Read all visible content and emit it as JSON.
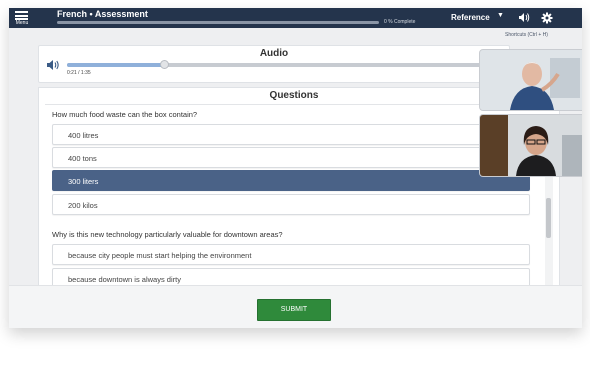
{
  "topbar": {
    "menu_label": "Menu",
    "title": "French • Assessment",
    "progress_text": "0 % Complete",
    "progress_fraction": 0,
    "reference_label": "Reference"
  },
  "shortcuts_label": "Shortcuts (Ctrl + H)",
  "audio": {
    "title": "Audio",
    "time": "0:21 / 1:35",
    "played_fraction": 0.22
  },
  "questions": {
    "title": "Questions",
    "items": [
      {
        "text": "How much food waste can the box contain?",
        "options": [
          "400 litres",
          "400 tons",
          "300 liters",
          "200 kilos"
        ],
        "selected": "300 liters"
      },
      {
        "text": "Why is this new technology particularly valuable for downtown areas?",
        "options": [
          "because city people must start helping the environment",
          "because downtown is always dirty"
        ]
      }
    ]
  },
  "submit_label": "SUBMIT",
  "colors": {
    "topbar": "#24344c",
    "selected_option": "#4a6287",
    "submit": "#2f8a3b"
  }
}
